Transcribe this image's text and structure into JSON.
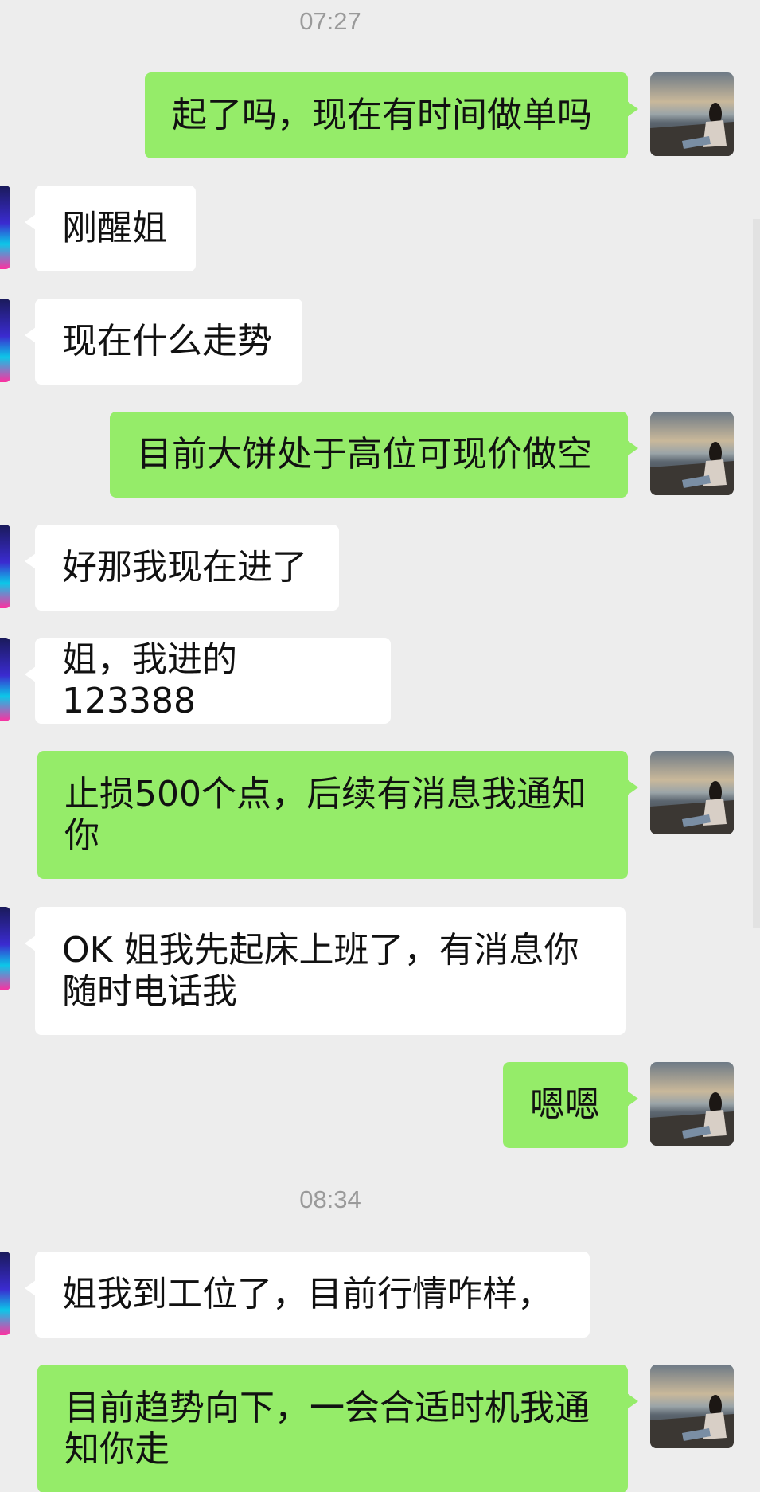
{
  "chat": {
    "timestamps": [
      "07:27",
      "08:34"
    ],
    "messages": [
      {
        "from": "me",
        "text": "起了吗，现在有时间做单吗"
      },
      {
        "from": "other",
        "text": "刚醒姐"
      },
      {
        "from": "other",
        "text": "现在什么走势"
      },
      {
        "from": "me",
        "text": "目前大饼处于高位可现价做空"
      },
      {
        "from": "other",
        "text": "好那我现在进了"
      },
      {
        "from": "other",
        "text": "姐，我进的123388"
      },
      {
        "from": "me",
        "text": "止损500个点，后续有消息我通知你"
      },
      {
        "from": "other",
        "text": "OK 姐我先起床上班了，有消息你随时电话我"
      },
      {
        "from": "me",
        "text": "嗯嗯"
      },
      {
        "from": "other",
        "text": "姐我到工位了，目前行情咋样，"
      },
      {
        "from": "me",
        "text": "目前趋势向下，一会合适时机我通知你走"
      }
    ]
  },
  "colors": {
    "background": "#ededed",
    "outgoing_bubble": "#95ec69",
    "incoming_bubble": "#ffffff",
    "timestamp_text": "#9a9a9a"
  }
}
